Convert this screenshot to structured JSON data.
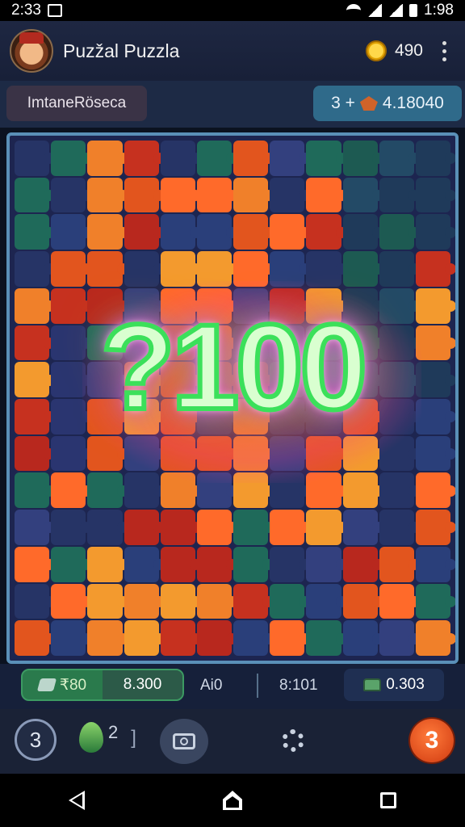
{
  "status_bar": {
    "time": "2:33",
    "clock_right": "1:98"
  },
  "app_bar": {
    "title": "Puzžal Puzzla",
    "coins": "490"
  },
  "info_bar": {
    "mode_label": "ImtaneRöseca",
    "score_prefix": "3 +",
    "score_value": "4.18040"
  },
  "board": {
    "big_number": "?100"
  },
  "bottom_stats": {
    "green_left": "₹80",
    "green_right": "8.300",
    "label": "Ai0",
    "middle": "8:101",
    "right": "0.303"
  },
  "toolbar": {
    "undo_label": "3",
    "hint_count": "2",
    "hint_bracket": "]",
    "lives": "3"
  },
  "colors": {
    "accent": "#2f6a8a",
    "board_border": "#5a90b8",
    "lives": "#d03a10"
  },
  "icons": [
    "avatar",
    "coin-icon",
    "menu-icon",
    "leaf-icon",
    "gem-icon",
    "chest-icon",
    "undo-icon",
    "drop-icon",
    "camera-icon",
    "gear-icon",
    "nav-back-icon",
    "nav-home-icon",
    "nav-recents-icon"
  ]
}
